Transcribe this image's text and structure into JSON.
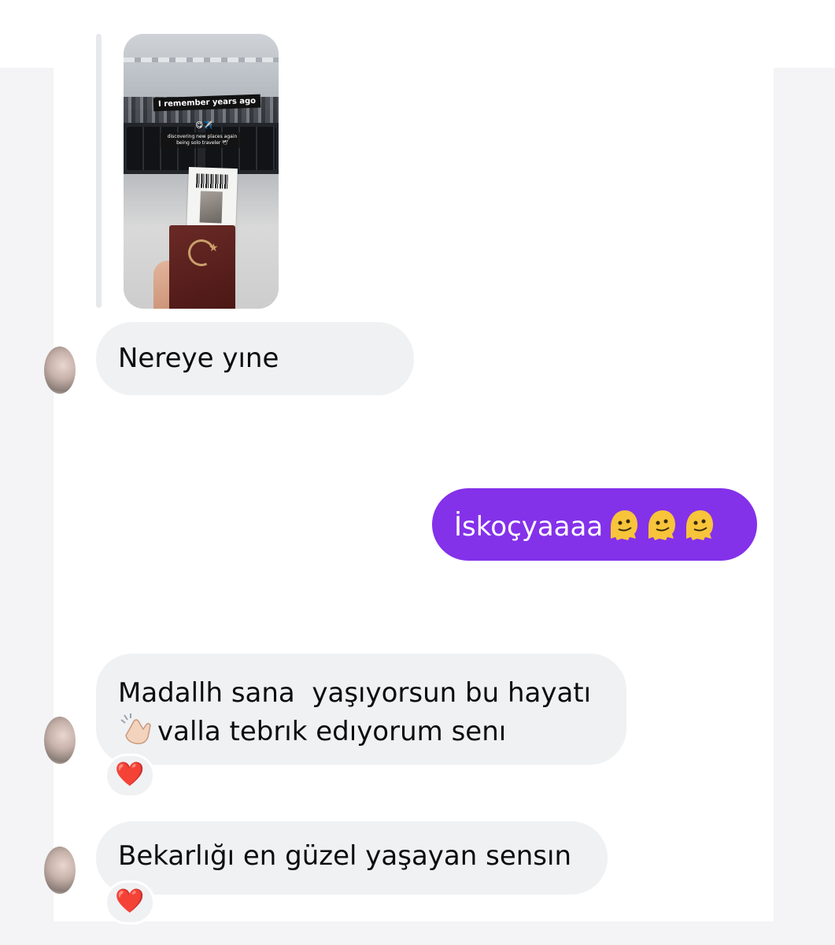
{
  "story": {
    "title": "I remember years ago",
    "emoji": "😋✈️",
    "subtitle": "discovering new places again being solo traveler 🕊"
  },
  "messages": [
    {
      "sender": "other",
      "text": "Nereye yıne"
    },
    {
      "sender": "me",
      "text": "İskoçyaaaa",
      "emoji": "melting-face-icon"
    },
    {
      "sender": "other",
      "line1": "Madallh sana  yaşıyorsun bu hayatı",
      "line2": "valla tebrık edıyorum senı",
      "reaction": "❤️"
    },
    {
      "sender": "other",
      "text": "Bekarlığı en güzel yaşayan sensın",
      "reaction": "❤️"
    }
  ],
  "colors": {
    "outgoing_bubble": "#8431ea",
    "incoming_bubble": "#eff1f3",
    "reaction_heart": "#e0142d"
  }
}
